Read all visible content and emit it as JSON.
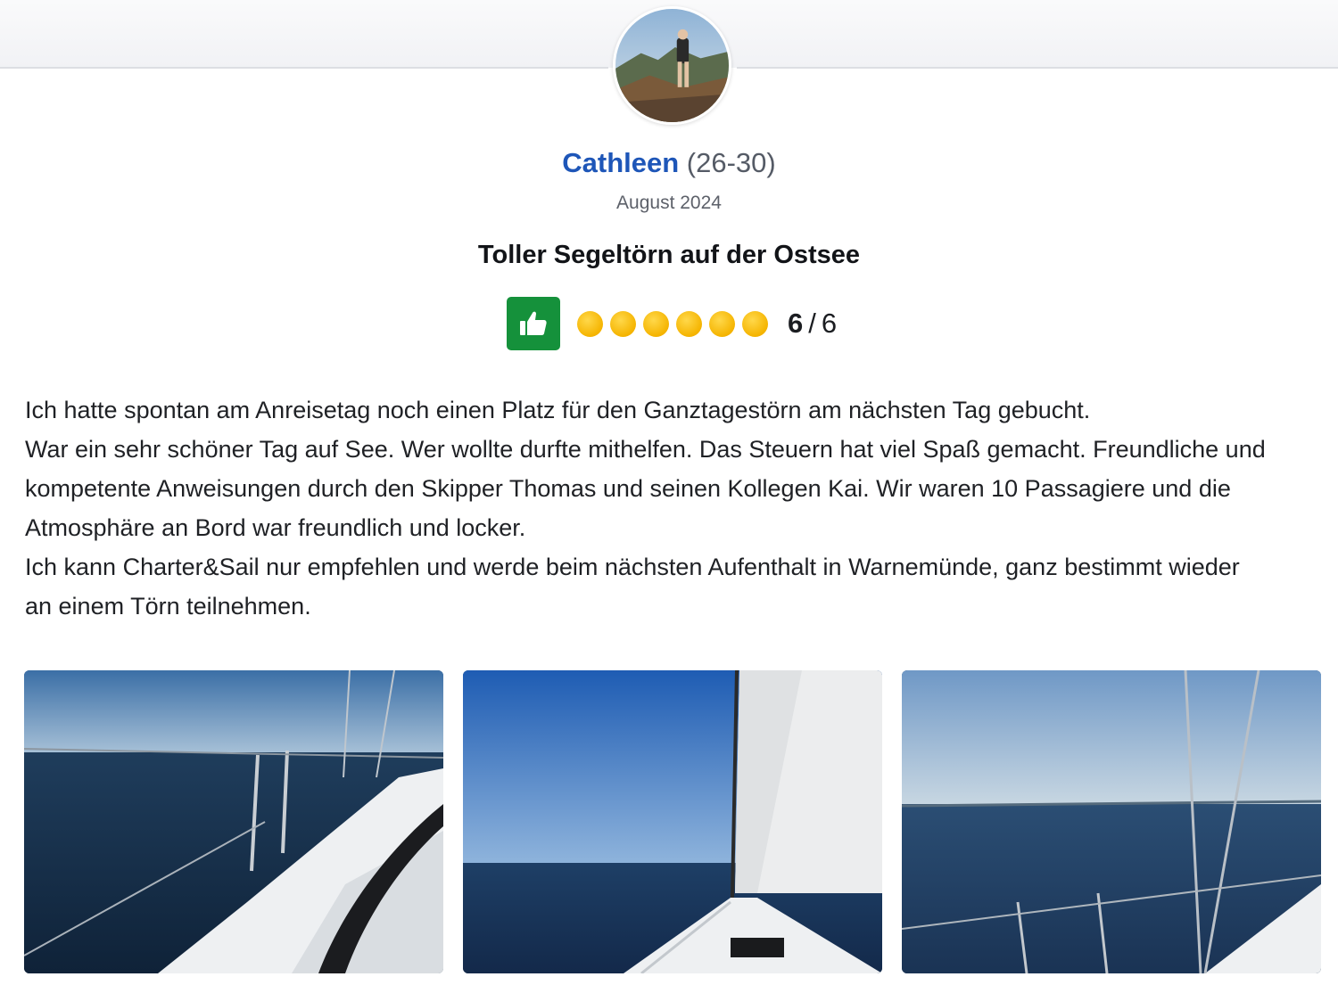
{
  "review": {
    "reviewer_name": "Cathleen",
    "reviewer_age": "(26-30)",
    "date": "August 2024",
    "title": "Toller Segeltörn auf der Ostsee",
    "recommend_icon": "thumbs-up-icon",
    "rating": {
      "value": "6",
      "separator": "/",
      "max": "6",
      "filled_dots": 6
    },
    "body": [
      "Ich hatte spontan am Anreisetag noch einen Platz für den Ganztagestörn am nächsten Tag gebucht.",
      "War ein sehr schöner Tag auf See. Wer wollte durfte mithelfen. Das Steuern hat viel Spaß gemacht. Freundliche und",
      "kompetente Anweisungen durch den Skipper Thomas und seinen Kollegen Kai. Wir waren 10 Passagiere und die",
      "Atmosphäre an Bord war freundlich und locker.",
      "Ich kann Charter&Sail nur empfehlen und werde beim nächsten Aufenthalt in Warnemünde, ganz bestimmt wieder",
      "an einem Törn teilnehmen."
    ]
  },
  "colors": {
    "name": "#1e56b8",
    "badge": "#15913b",
    "dot": "#f5b400"
  }
}
